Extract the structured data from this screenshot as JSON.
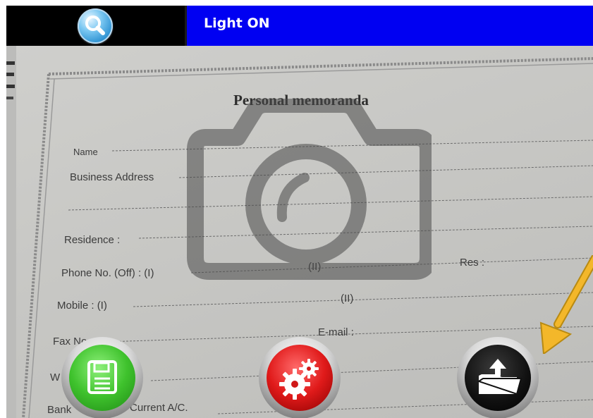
{
  "topbar": {
    "search_icon": "search-icon",
    "light_label": "Light ON",
    "colors": {
      "left_bg": "#000000",
      "right_bg": "#0000f2",
      "text": "#ffffff"
    }
  },
  "preview": {
    "overlay_icon": "camera-icon",
    "arrow_icon": "arrow-indicator-icon",
    "document": {
      "title": "Personal memoranda",
      "name_label": "Name",
      "business_label": "Business Address",
      "residence_label": "Residence :",
      "phone_label": "Phone No. (Off) : (I)",
      "phone_ii": "(II)",
      "res_label": "Res :",
      "mobile_label": "Mobile : (I)",
      "mobile_ii": "(II)",
      "fax_label": "Fax No",
      "email_label": "E-mail :",
      "w_label": "W",
      "bank_left": "Bank",
      "bank_right": "Current A/C."
    }
  },
  "buttons": {
    "save_icon": "floppy-disk-icon",
    "settings_icon": "gears-icon",
    "export_icon": "folder-upload-icon"
  }
}
